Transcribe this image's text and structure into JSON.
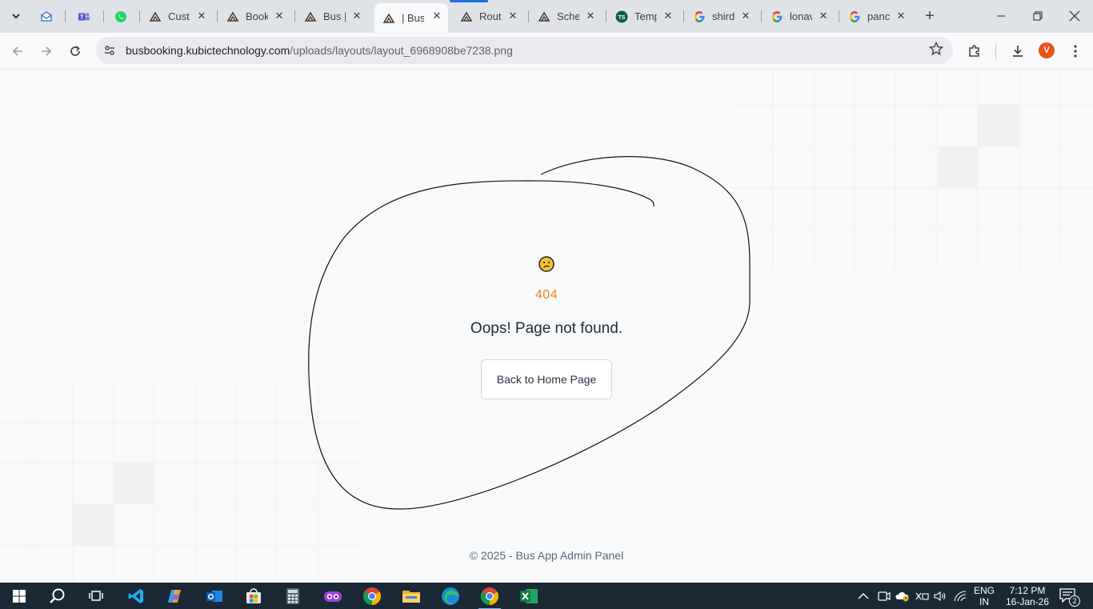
{
  "browser": {
    "tabs": [
      {
        "title": "Cust",
        "icon": "bus-logo-icon"
      },
      {
        "title": "Book",
        "icon": "bus-logo-icon"
      },
      {
        "title": "Bus |",
        "icon": "bus-logo-icon"
      },
      {
        "title": "| Bus",
        "icon": "bus-logo-icon",
        "active": true
      },
      {
        "title": "Rout",
        "icon": "bus-logo-icon"
      },
      {
        "title": "Sche",
        "icon": "bus-logo-icon"
      },
      {
        "title": "Temp",
        "icon": "template-site-icon"
      },
      {
        "title": "shird",
        "icon": "google-icon"
      },
      {
        "title": "lonav",
        "icon": "google-icon"
      },
      {
        "title": "panc",
        "icon": "google-icon"
      }
    ],
    "pinned_tabs": [
      "outlook-icon",
      "teams-icon",
      "whatsapp-icon"
    ],
    "url_host": "busbooking.kubictechnology.com",
    "url_path": "/uploads/layouts/layout_6968908be7238.png",
    "profile_initial": "V"
  },
  "page": {
    "emoji": "confused-face-icon",
    "code": "404",
    "message": "Oops! Page not found.",
    "button_label": "Back to Home Page",
    "footer": "© 2025 - Bus App Admin Panel",
    "accent_color": "#f0811d"
  },
  "taskbar": {
    "apps": [
      "windows-start-icon",
      "search-icon",
      "task-view-icon",
      "vscode-icon",
      "copilot-icon",
      "outlook-icon",
      "store-icon",
      "calculator-icon",
      "vr-app-icon",
      "chrome-icon",
      "file-explorer-icon",
      "edge-icon",
      "chrome-active-icon",
      "excel-icon"
    ],
    "lang_top": "ENG",
    "lang_bottom": "IN",
    "time": "7:12 PM",
    "date": "16-Jan-26",
    "notification_count": "2"
  }
}
